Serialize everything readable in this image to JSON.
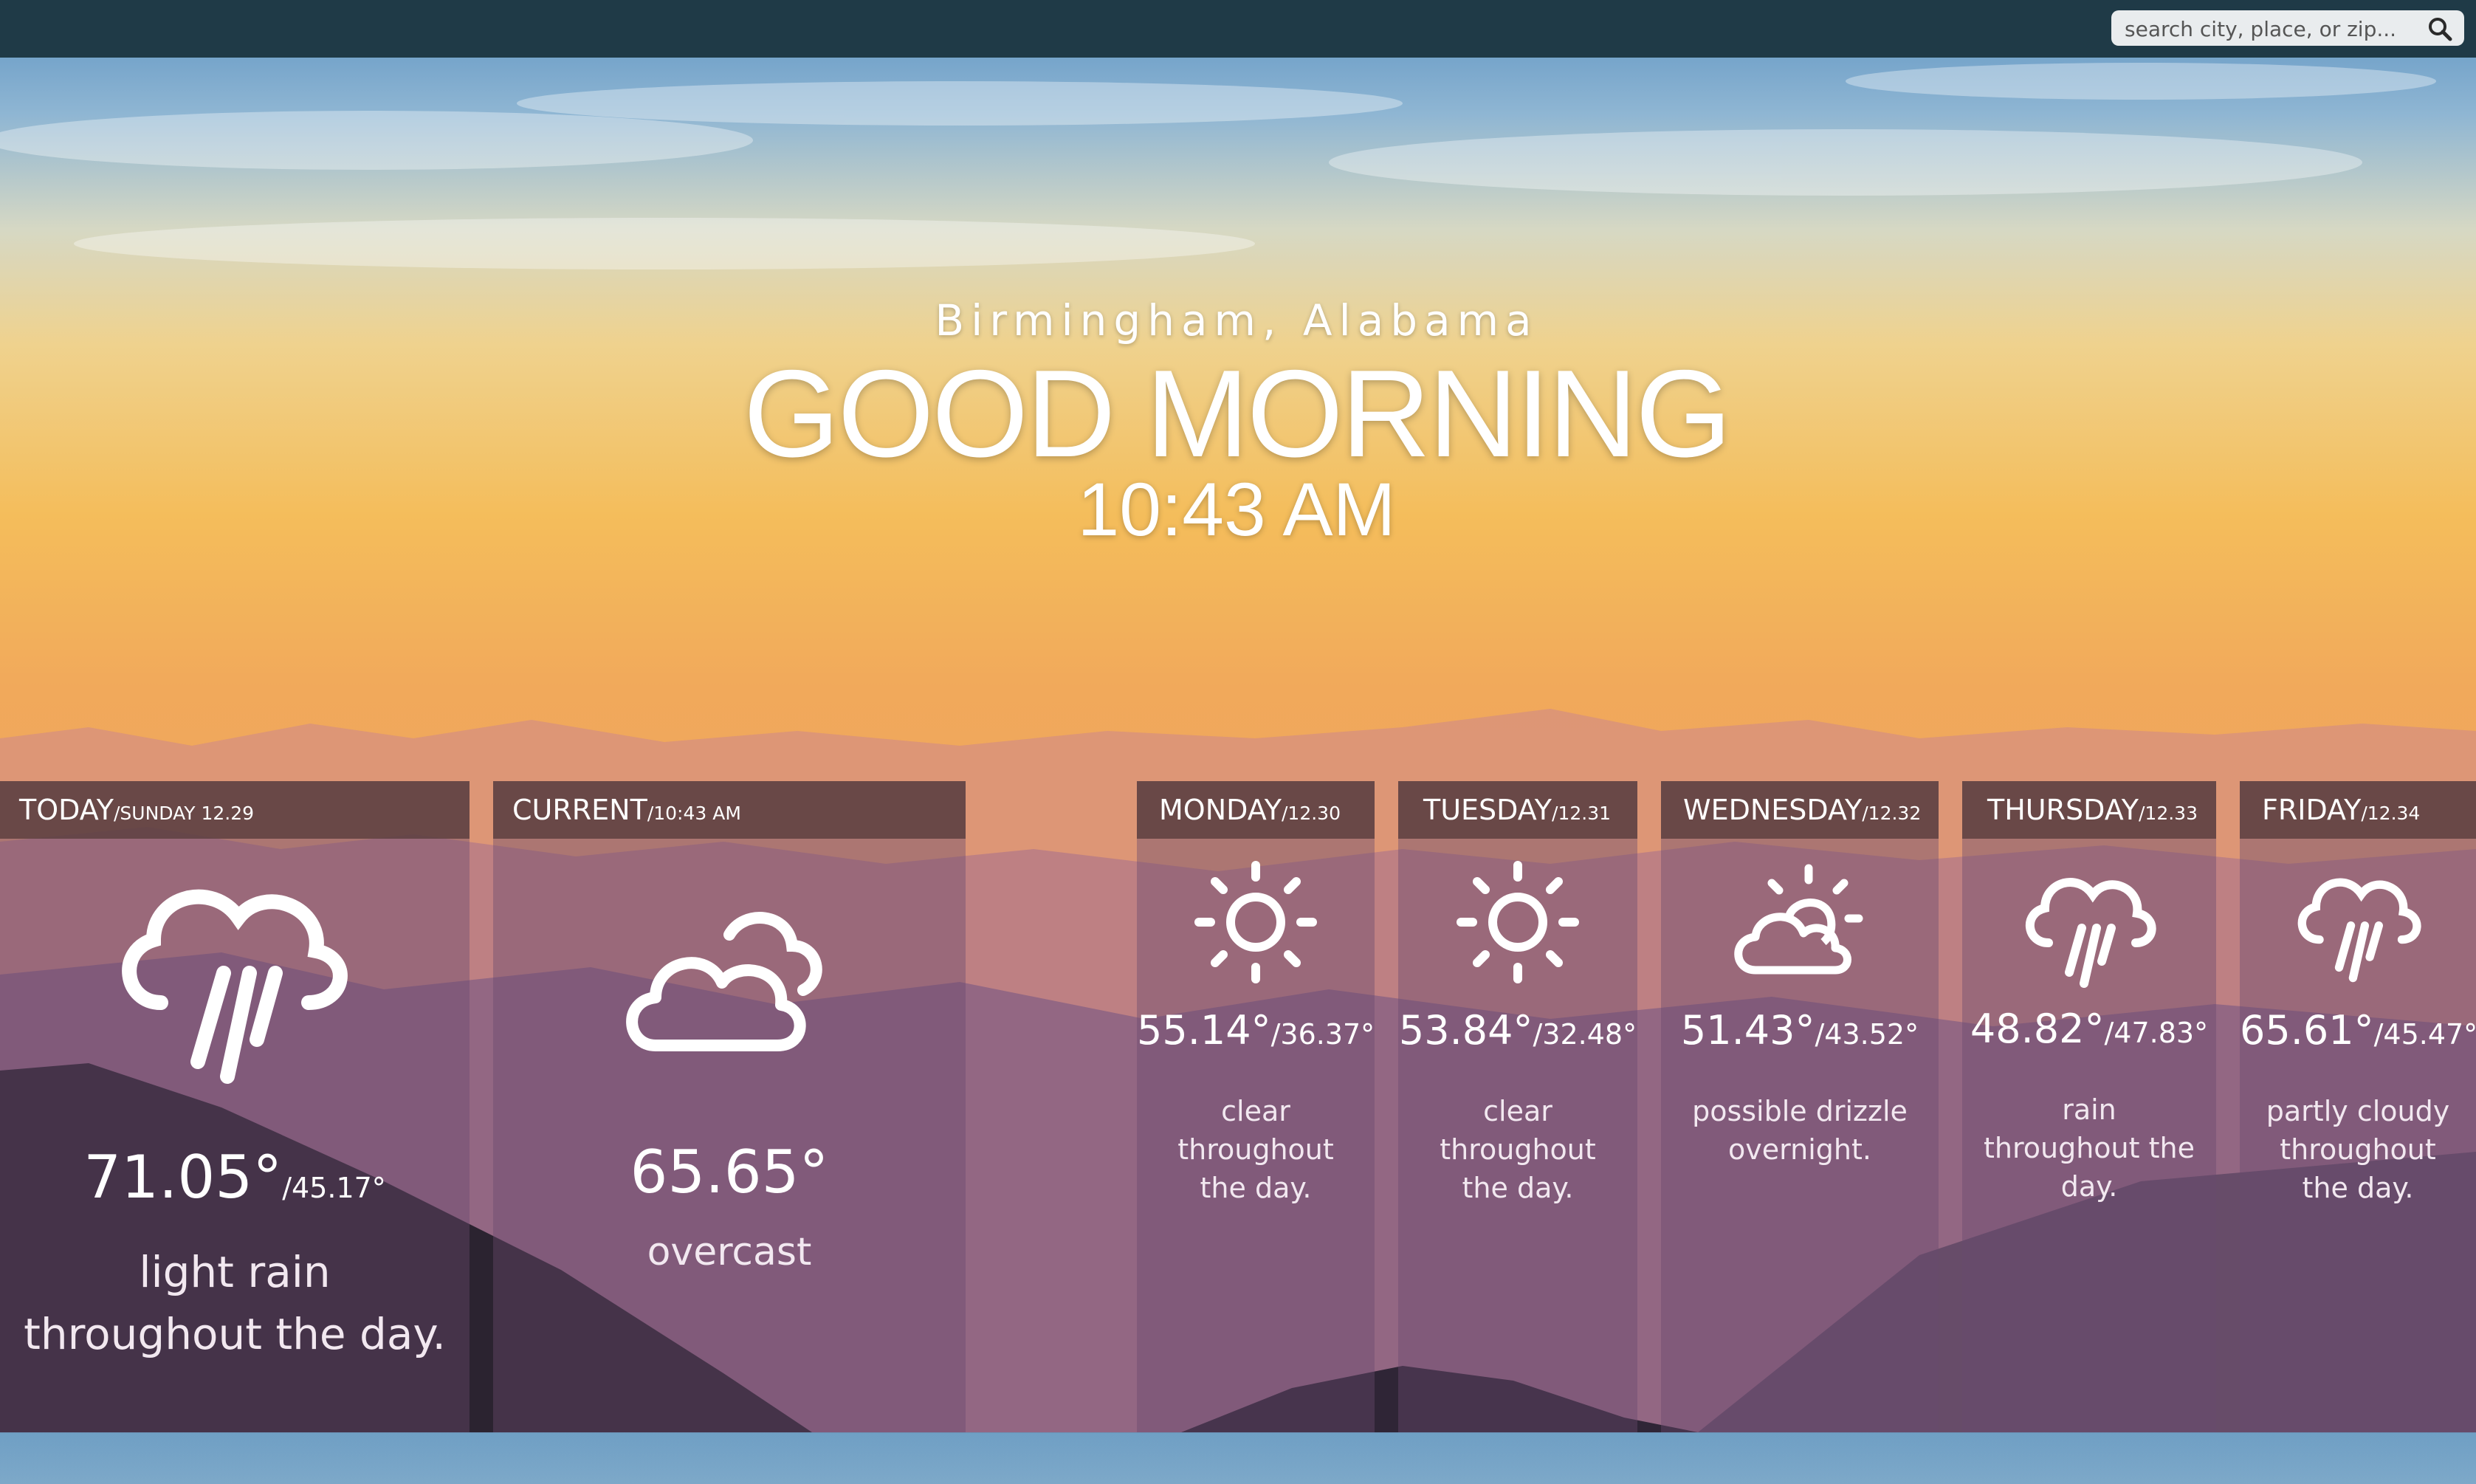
{
  "search": {
    "placeholder": "search city, place, or zip..."
  },
  "location": "Birmingham, Alabama",
  "greeting": "GOOD MORNING",
  "time": "10:43 AM",
  "today": {
    "day": "TODAY",
    "date": "/SUNDAY 12.29",
    "icon": "rain-icon",
    "high": "71.05°",
    "low": "/45.17°",
    "summary": "light rain throughout the day."
  },
  "current": {
    "label": "CURRENT",
    "time": "/10:43 AM",
    "icon": "cloudy-icon",
    "temp": "65.65°",
    "summary": "overcast"
  },
  "forecast": [
    {
      "day": "MONDAY",
      "date": "/12.30",
      "icon": "sun-icon",
      "high": "55.14°",
      "low": "/36.37°",
      "summary": "clear throughout the day."
    },
    {
      "day": "TUESDAY",
      "date": "/12.31",
      "icon": "sun-icon",
      "high": "53.84°",
      "low": "/32.48°",
      "summary": "clear throughout the day."
    },
    {
      "day": "WEDNESDAY",
      "date": "/12.32",
      "icon": "partly-cloudy-icon",
      "high": "51.43°",
      "low": "/43.52°",
      "summary": "possible drizzle overnight."
    },
    {
      "day": "THURSDAY",
      "date": "/12.33",
      "icon": "rain-icon",
      "high": "48.82°",
      "low": "/47.83°",
      "summary": "rain throughout the day."
    },
    {
      "day": "FRIDAY",
      "date": "/12.34",
      "icon": "rain-icon",
      "high": "65.61°",
      "low": "/45.47°",
      "summary": "partly cloudy throughout the day."
    }
  ]
}
